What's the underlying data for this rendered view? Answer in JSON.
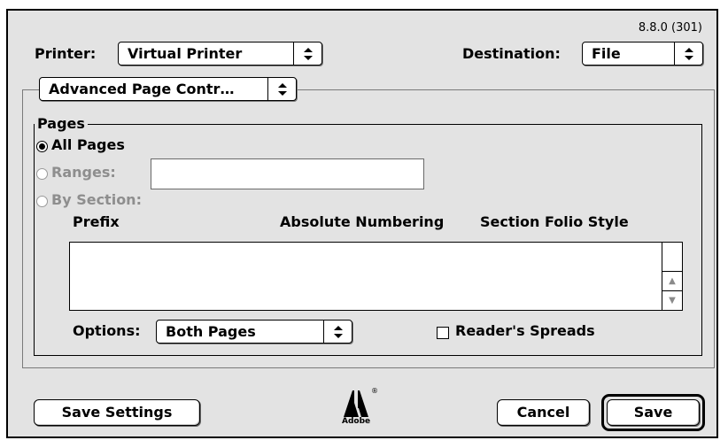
{
  "version": "8.8.0 (301)",
  "printer": {
    "label": "Printer:",
    "value": "Virtual Printer"
  },
  "destination": {
    "label": "Destination:",
    "value": "File"
  },
  "panel_menu": {
    "value": "Advanced Page Contr…"
  },
  "pages_group": {
    "title": "Pages",
    "all_pages": {
      "label": "All Pages",
      "selected": true
    },
    "ranges": {
      "label": "Ranges:",
      "value": "",
      "enabled": false
    },
    "by_section": {
      "label": "By Section:",
      "enabled": false
    },
    "columns": [
      "Prefix",
      "Absolute Numbering",
      "Section Folio Style"
    ],
    "rows": []
  },
  "options": {
    "label": "Options:",
    "value": "Both Pages"
  },
  "readers_spreads": {
    "label": "Reader's Spreads",
    "checked": false
  },
  "logo": {
    "text": "Adobe",
    "mark": "®"
  },
  "buttons": {
    "save_settings": "Save Settings",
    "cancel": "Cancel",
    "save": "Save"
  },
  "icons": {
    "popup_arrows": "up-down-arrows-icon",
    "scroll_up": "scroll-up-arrow-icon",
    "scroll_down": "scroll-down-arrow-icon"
  }
}
